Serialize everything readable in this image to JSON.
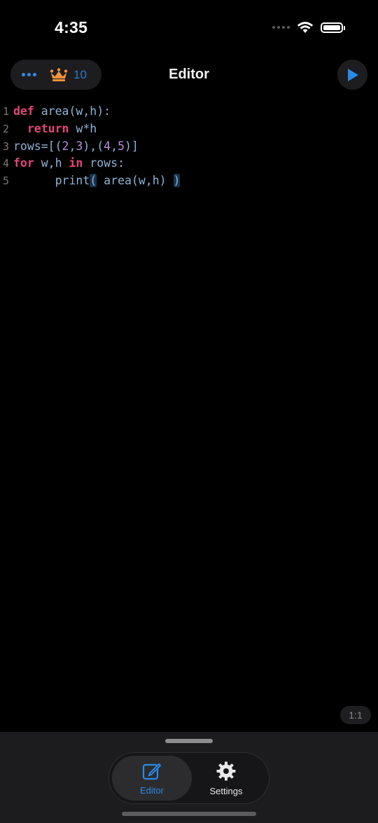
{
  "status_bar": {
    "time": "4:35"
  },
  "nav": {
    "title": "Editor",
    "crown_count": "10",
    "more_icon": "ellipsis-icon",
    "crown_icon": "crown-icon",
    "run_icon": "play-icon"
  },
  "editor": {
    "lines": [
      {
        "number": "1"
      },
      {
        "number": "2"
      },
      {
        "number": "3"
      },
      {
        "number": "4"
      },
      {
        "number": "5"
      }
    ],
    "tokens": {
      "l1_kw": "def",
      "l1_rest": " area(w,h):",
      "l2_kw": "return",
      "l2_rest": " w*h",
      "l3_a": "rows=[(",
      "l3_n1": "2",
      "l3_b": ",",
      "l3_n2": "3",
      "l3_c": "),(",
      "l3_n3": "4",
      "l3_d": ",",
      "l3_n4": "5",
      "l3_e": ")]",
      "l4_kw1": "for",
      "l4_mid": " w,h ",
      "l4_kw2": "in",
      "l4_rest": " rows:",
      "l5_a": "print",
      "l5_open": "(",
      "l5_mid": " area(w,h) ",
      "l5_close": ")"
    },
    "cursor_position": "1:1"
  },
  "tabbar": {
    "tabs": [
      {
        "label": "Editor",
        "icon": "edit-icon",
        "selected": true
      },
      {
        "label": "Settings",
        "icon": "gear-icon",
        "selected": false
      }
    ]
  },
  "colors": {
    "accent": "#2a8ae6",
    "keyword": "#e0457b",
    "number": "#b98ee0",
    "crown": "#f5923a"
  }
}
